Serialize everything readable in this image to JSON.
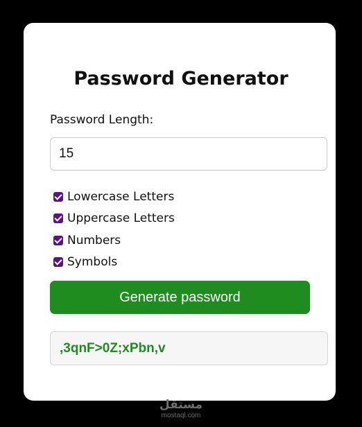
{
  "app": {
    "title": "Password Generator"
  },
  "form": {
    "length_label": "Password Length:",
    "length_value": "15",
    "options": [
      {
        "label": "Lowercase Letters",
        "checked": true
      },
      {
        "label": "Uppercase Letters",
        "checked": true
      },
      {
        "label": "Numbers",
        "checked": true
      },
      {
        "label": "Symbols",
        "checked": true
      }
    ],
    "generate_label": "Generate password",
    "result": ",3qnF>0Z;xPbn,v"
  },
  "watermark": {
    "logo_text": "مستقل",
    "url": "mostaql.com"
  },
  "colors": {
    "background": "#000000",
    "card": "#ffffff",
    "accent": "#1e8c1e",
    "checkbox": "#5b1282"
  }
}
